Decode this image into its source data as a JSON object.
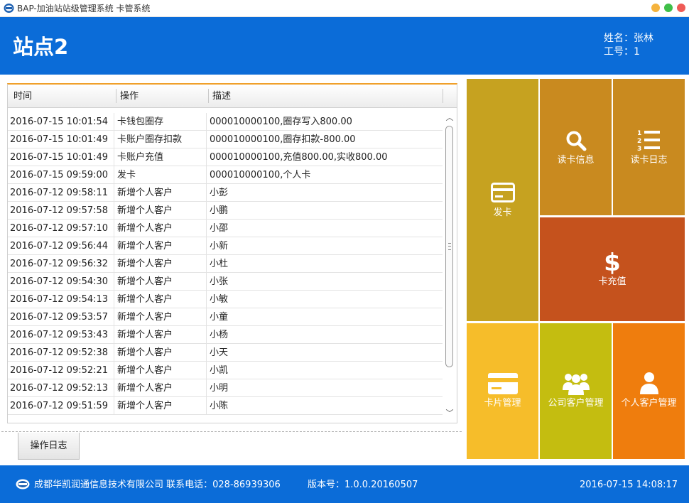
{
  "window": {
    "title": "BAP-加油站站级管理系统 卡管系统",
    "buttons": {
      "minimize_color": "#f5b33d",
      "maximize_color": "#3fbf49",
      "close_color": "#ef5b56"
    }
  },
  "header": {
    "station": "站点2",
    "user_name": "姓名：张林",
    "user_id": "工号：1"
  },
  "log_table": {
    "columns": [
      "时间",
      "操作",
      "描述"
    ],
    "rows": [
      [
        "2016-07-15 10:01:54",
        "卡钱包圈存",
        "000010000100,圈存写入800.00"
      ],
      [
        "2016-07-15 10:01:49",
        "卡账户圈存扣款",
        "000010000100,圈存扣款-800.00"
      ],
      [
        "2016-07-15 10:01:49",
        "卡账户充值",
        "000010000100,充值800.00,实收800.00"
      ],
      [
        "2016-07-15 09:59:00",
        "发卡",
        "000010000100,个人卡"
      ],
      [
        "2016-07-12 09:58:11",
        "新增个人客户",
        "小彭"
      ],
      [
        "2016-07-12 09:57:58",
        "新增个人客户",
        "小鹏"
      ],
      [
        "2016-07-12 09:57:10",
        "新增个人客户",
        "小邵"
      ],
      [
        "2016-07-12 09:56:44",
        "新增个人客户",
        "小新"
      ],
      [
        "2016-07-12 09:56:32",
        "新增个人客户",
        "小杜"
      ],
      [
        "2016-07-12 09:54:30",
        "新增个人客户",
        "小张"
      ],
      [
        "2016-07-12 09:54:13",
        "新增个人客户",
        "小敏"
      ],
      [
        "2016-07-12 09:53:57",
        "新增个人客户",
        "小童"
      ],
      [
        "2016-07-12 09:53:43",
        "新增个人客户",
        "小杨"
      ],
      [
        "2016-07-12 09:52:38",
        "新增个人客户",
        "小天"
      ],
      [
        "2016-07-12 09:52:21",
        "新增个人客户",
        "小凯"
      ],
      [
        "2016-07-12 09:52:13",
        "新增个人客户",
        "小明"
      ],
      [
        "2016-07-12 09:51:59",
        "新增个人客户",
        "小陈"
      ]
    ]
  },
  "bottom_tab": {
    "label": "操作日志"
  },
  "tiles": {
    "issue_card": {
      "label": "发卡",
      "color": "#c6a220",
      "icon": "card-icon"
    },
    "read_card_info": {
      "label": "读卡信息",
      "color": "#c98a1f",
      "icon": "search-icon"
    },
    "read_card_log": {
      "label": "读卡日志",
      "color": "#c98a1f",
      "icon": "numbered-list-icon"
    },
    "card_recharge": {
      "label": "卡充值",
      "color": "#c5521d",
      "icon": "dollar-icon"
    },
    "card_management": {
      "label": "卡片管理",
      "color": "#f6bd2a",
      "icon": "card-icon"
    },
    "company_customer": {
      "label": "公司客户管理",
      "color": "#c4bd10",
      "icon": "group-icon"
    },
    "personal_customer": {
      "label": "个人客户管理",
      "color": "#ef7d0d",
      "icon": "person-icon"
    }
  },
  "footer": {
    "company": "成都华凯润通信息技术有限公司 联系电话：028-86939306",
    "version": "版本号：1.0.0.20160507",
    "clock": "2016-07-15 14:08:17"
  }
}
